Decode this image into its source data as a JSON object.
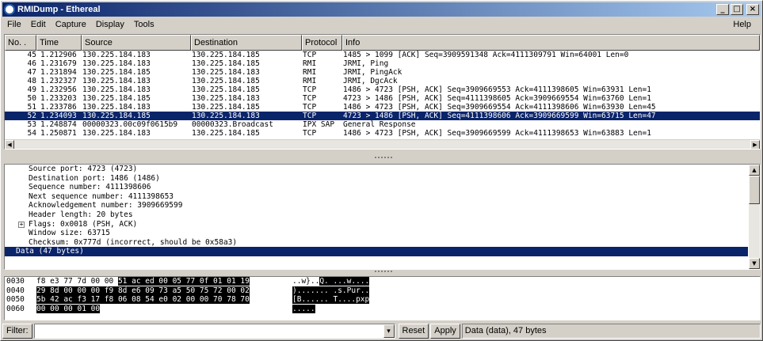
{
  "window": {
    "title": "RMIDump - Ethereal"
  },
  "menu": {
    "items": [
      "File",
      "Edit",
      "Capture",
      "Display",
      "Tools"
    ],
    "help": "Help"
  },
  "packet_list": {
    "columns": [
      "No. .",
      "Time",
      "Source",
      "Destination",
      "Protocol",
      "Info"
    ],
    "rows": [
      {
        "no": "45",
        "time": "1.212906",
        "src": "130.225.184.183",
        "dst": "130.225.184.185",
        "proto": "TCP",
        "info": "1485 > 1099 [ACK] Seq=3909591348 Ack=4111309791 Win=64001 Len=0"
      },
      {
        "no": "46",
        "time": "1.231679",
        "src": "130.225.184.183",
        "dst": "130.225.184.185",
        "proto": "RMI",
        "info": "JRMI, Ping"
      },
      {
        "no": "47",
        "time": "1.231894",
        "src": "130.225.184.185",
        "dst": "130.225.184.183",
        "proto": "RMI",
        "info": "JRMI, PingAck"
      },
      {
        "no": "48",
        "time": "1.232327",
        "src": "130.225.184.183",
        "dst": "130.225.184.185",
        "proto": "RMI",
        "info": "JRMI, DgcAck"
      },
      {
        "no": "49",
        "time": "1.232956",
        "src": "130.225.184.183",
        "dst": "130.225.184.185",
        "proto": "TCP",
        "info": "1486 > 4723 [PSH, ACK] Seq=3909669553 Ack=4111398605 Win=63931 Len=1"
      },
      {
        "no": "50",
        "time": "1.233203",
        "src": "130.225.184.185",
        "dst": "130.225.184.183",
        "proto": "TCP",
        "info": "4723 > 1486 [PSH, ACK] Seq=4111398605 Ack=3909669554 Win=63760 Len=1"
      },
      {
        "no": "51",
        "time": "1.233786",
        "src": "130.225.184.183",
        "dst": "130.225.184.185",
        "proto": "TCP",
        "info": "1486 > 4723 [PSH, ACK] Seq=3909669554 Ack=4111398606 Win=63930 Len=45"
      },
      {
        "no": "52",
        "time": "1.234093",
        "src": "130.225.184.185",
        "dst": "130.225.184.183",
        "proto": "TCP",
        "info": "4723 > 1486 [PSH, ACK] Seq=4111398606 Ack=3909669599 Win=63715 Len=47"
      },
      {
        "no": "53",
        "time": "1.248874",
        "src": "00000323.00c09f0615b9",
        "dst": "00000323.Broadcast",
        "proto": "IPX SAP",
        "info": "General Response"
      },
      {
        "no": "54",
        "time": "1.250871",
        "src": "130.225.184.183",
        "dst": "130.225.184.185",
        "proto": "TCP",
        "info": "1486 > 4723 [PSH, ACK] Seq=3909669599 Ack=4111398653 Win=63883 Len=1"
      }
    ],
    "selected_index": 7
  },
  "details": {
    "lines": [
      "Source port: 4723 (4723)",
      "Destination port: 1486 (1486)",
      "Sequence number: 4111398606",
      "Next sequence number: 4111398653",
      "Acknowledgement number: 3909669599",
      "Header length: 20 bytes"
    ],
    "flags_line": "Flags: 0x0018 (PSH, ACK)",
    "expander": "+",
    "lines2": [
      "Window size: 63715",
      "Checksum: 0x777d (incorrect, should be 0x58a3)"
    ],
    "selected_line": "Data (47 bytes)"
  },
  "hex": {
    "rows": [
      {
        "off": "0030",
        "hex_plain": "f8 e3 77 7d 00 00 ",
        "hex_hl": "51 ac  ed 00 05 77 0f 01 01 19",
        "asc_plain": "..w}..",
        "asc_hl": "Q. ...w...."
      },
      {
        "off": "0040",
        "hex_plain": "",
        "hex_hl": "29 8d 00 00 00 f9 8d e6  09 73 a5 50 75 72 00 02",
        "asc_plain": "",
        "asc_hl": ")....... .s.Pur.."
      },
      {
        "off": "0050",
        "hex_plain": "",
        "hex_hl": "5b 42 ac f3 17 f8 06 08  54 e0 02 00 00 70 78 70",
        "asc_plain": "",
        "asc_hl": "[B...... T....pxp"
      },
      {
        "off": "0060",
        "hex_plain": "",
        "hex_hl": "00 00 00 01 00",
        "asc_plain": "",
        "asc_hl": "....."
      }
    ]
  },
  "filterbar": {
    "filter_label": "Filter:",
    "filter_value": "",
    "reset_label": "Reset",
    "apply_label": "Apply",
    "status": "Data (data), 47 bytes"
  }
}
